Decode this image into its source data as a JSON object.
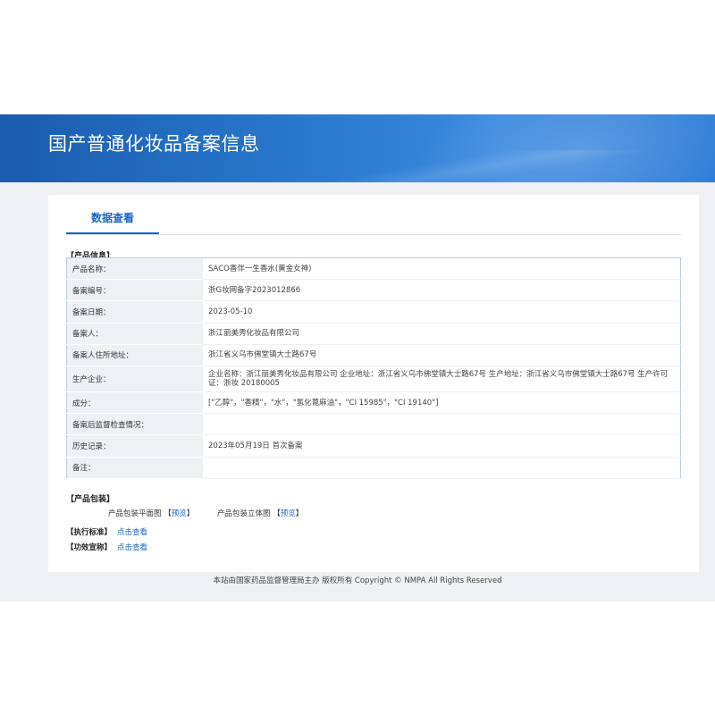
{
  "header": {
    "title": "国产普通化妆品备案信息"
  },
  "tabs": [
    {
      "label": "数据查看"
    }
  ],
  "product_info": {
    "section_label": "【产品信息】",
    "rows": [
      {
        "key": "产品名称：",
        "value": "SACO香伴一生香水(黄金女神)"
      },
      {
        "key": "备案编号：",
        "value": "浙G妆网备字2023012866"
      },
      {
        "key": "备案日期：",
        "value": "2023-05-10"
      },
      {
        "key": "备案人：",
        "value": "浙江丽美秀化妆品有限公司"
      },
      {
        "key": "备案人住所地址：",
        "value": "浙江省义乌市佛堂镇大士路67号"
      },
      {
        "key": "生产企业：",
        "value": "企业名称：浙江丽美秀化妆品有限公司 企业地址：浙江省义乌市佛堂镇大士路67号 生产地址：浙江省义乌市佛堂镇大士路67号 生产许可证：浙妆 20180005"
      },
      {
        "key": "成分：",
        "value": "[\"乙醇\"，\"香精\"，\"水\"，\"氢化蓖麻油\"，\"CI 15985\"，\"CI 19140\"]"
      },
      {
        "key": "备案后监督检查情况：",
        "value": ""
      },
      {
        "key": "历史记录：",
        "value": "2023年05月19日 首次备案"
      },
      {
        "key": "备注：",
        "value": ""
      }
    ]
  },
  "packaging": {
    "section_label": "【产品包装】",
    "items": [
      {
        "label": "产品包装平面图",
        "bracket_open": "【",
        "link": "预览",
        "bracket_close": "】"
      },
      {
        "label": "产品包装立体图",
        "bracket_open": "【",
        "link": "预览",
        "bracket_close": "】"
      }
    ]
  },
  "standard": {
    "label": "【执行标准】",
    "link": "点击查看"
  },
  "efficacy": {
    "label": "【功效宣称】",
    "link": "点击查看"
  },
  "footer": {
    "text": "本站由国家药品监督管理局主办 版权所有 Copyright © NMPA All Rights Reserved"
  },
  "colors": {
    "banner": "#1f6bc4",
    "accent": "#1a66c0",
    "key_bg": "#eef0f4",
    "page_bg": "#eef0f3"
  }
}
